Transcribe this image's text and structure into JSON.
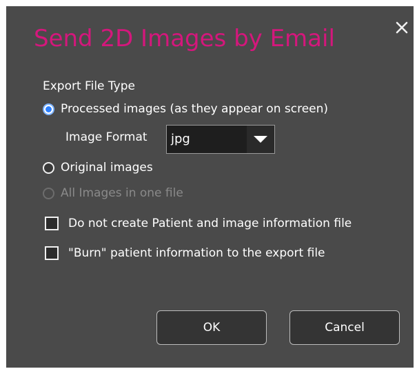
{
  "dialog": {
    "title": "Send 2D Images by Email",
    "close_icon": "close-icon"
  },
  "export_type": {
    "label": "Export File Type",
    "options": [
      {
        "label": "Processed images (as they appear on screen)",
        "selected": true,
        "enabled": true
      },
      {
        "label": "Original images",
        "selected": false,
        "enabled": true
      },
      {
        "label": "All Images in one file",
        "selected": false,
        "enabled": false
      }
    ]
  },
  "image_format": {
    "label": "Image Format",
    "value": "jpg"
  },
  "checkboxes": [
    {
      "label": "Do not create Patient and image information file",
      "checked": false
    },
    {
      "label": "\"Burn\" patient information to the export file",
      "checked": false
    }
  ],
  "buttons": {
    "ok": "OK",
    "cancel": "Cancel"
  },
  "colors": {
    "title": "#d4177c",
    "dialog_bg": "#4a4a4a",
    "radio_selected": "#2a7fff"
  }
}
